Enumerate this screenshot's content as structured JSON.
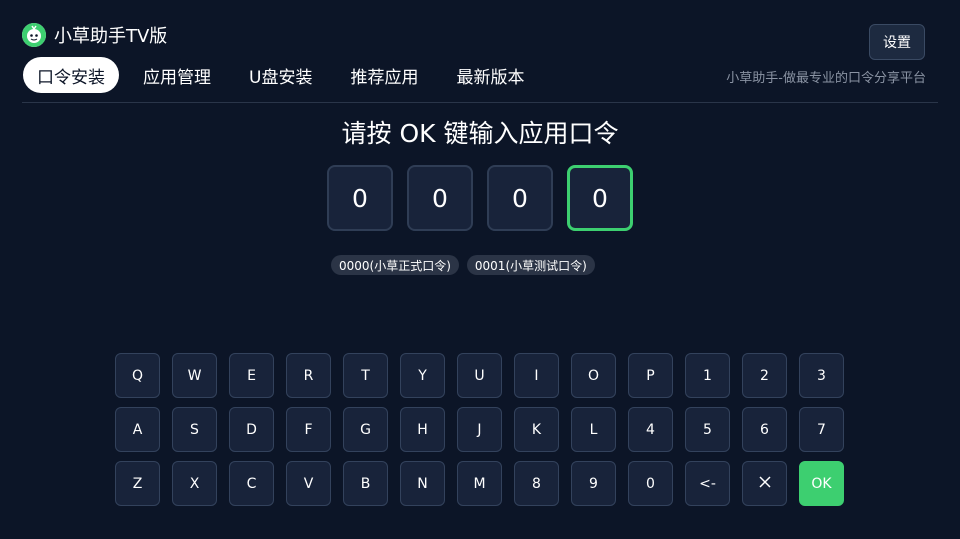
{
  "app": {
    "title": "小草助手TV版"
  },
  "header": {
    "settings_label": "设置",
    "slogan": "小草助手-做最专业的口令分享平台"
  },
  "nav": {
    "tabs": [
      {
        "label": "口令安装",
        "active": true
      },
      {
        "label": "应用管理"
      },
      {
        "label": "U盘安装"
      },
      {
        "label": "推荐应用"
      },
      {
        "label": "最新版本"
      }
    ]
  },
  "main": {
    "prompt": "请按 OK 键输入应用口令",
    "code_digits": [
      "0",
      "0",
      "0",
      "0"
    ],
    "presets": [
      "0000(小草正式口令)",
      "0001(小草测试口令)"
    ]
  },
  "keyboard": {
    "rows": [
      [
        "Q",
        "W",
        "E",
        "R",
        "T",
        "Y",
        "U",
        "I",
        "O",
        "P",
        "1",
        "2",
        "3"
      ],
      [
        "A",
        "S",
        "D",
        "F",
        "G",
        "H",
        "J",
        "K",
        "L",
        "4",
        "5",
        "6",
        "7"
      ],
      [
        "Z",
        "X",
        "C",
        "V",
        "B",
        "N",
        "M",
        "8",
        "9",
        "0",
        "<-",
        "×",
        "OK"
      ]
    ],
    "ok_color": "#3dcf70"
  },
  "colors": {
    "background": "#0c1527",
    "accent": "#3dcf70"
  }
}
